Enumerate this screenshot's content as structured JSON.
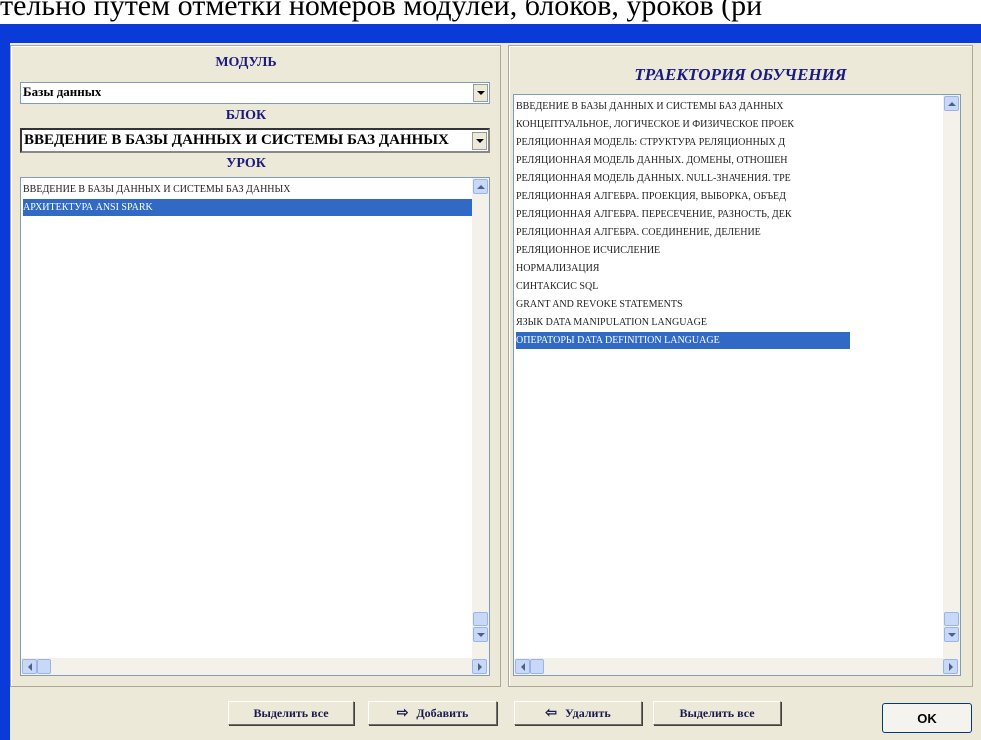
{
  "top_text": "тельно путем отметки номеров модулей, блоков, уроков (ри",
  "left": {
    "module_label": "МОДУЛЬ",
    "module_value": "Базы данных",
    "block_label": "БЛОК",
    "block_value": "ВВЕДЕНИЕ В БАЗЫ ДАННЫХ И СИСТЕМЫ  БАЗ ДАННЫХ",
    "lesson_label": "УРОК",
    "lessons": [
      {
        "text": "ВВЕДЕНИЕ В БАЗЫ ДАННЫХ И СИСТЕМЫ  БАЗ ДАННЫХ",
        "selected": false
      },
      {
        "text": "АРХИТЕКТУРА ANSI SPARK",
        "selected": true
      }
    ]
  },
  "right": {
    "title": "ТРАЕКТОРИЯ ОБУЧЕНИЯ",
    "items": [
      {
        "text": "ВВЕДЕНИЕ В БАЗЫ ДАННЫХ И СИСТЕМЫ  БАЗ ДАННЫХ",
        "selected": false
      },
      {
        "text": "КОНЦЕПТУАЛЬНОЕ, ЛОГИЧЕСКОЕ И ФИЗИЧЕСКОЕ ПРОЕК",
        "selected": false
      },
      {
        "text": "РЕЛЯЦИОННАЯ МОДЕЛЬ: СТРУКТУРА РЕЛЯЦИОННЫХ Д",
        "selected": false
      },
      {
        "text": "РЕЛЯЦИОННАЯ МОДЕЛЬ ДАННЫХ. ДОМЕНЫ, ОТНОШЕН",
        "selected": false
      },
      {
        "text": "РЕЛЯЦИОННАЯ МОДЕЛЬ ДАННЫХ. NULL-ЗНАЧЕНИЯ. ТРЕ",
        "selected": false
      },
      {
        "text": "РЕЛЯЦИОННАЯ АЛГЕБРА. ПРОЕКЦИЯ, ВЫБОРКА, ОБЪЕД",
        "selected": false
      },
      {
        "text": "РЕЛЯЦИОННАЯ АЛГЕБРА. ПЕРЕСЕЧЕНИЕ, РАЗНОСТЬ, ДЕК",
        "selected": false
      },
      {
        "text": "РЕЛЯЦИОННАЯ АЛГЕБРА. СОЕДИНЕНИЕ, ДЕЛЕНИЕ",
        "selected": false
      },
      {
        "text": "РЕЛЯЦИОННОЕ ИСЧИСЛЕНИЕ",
        "selected": false
      },
      {
        "text": "НОРМАЛИЗАЦИЯ",
        "selected": false
      },
      {
        "text": "СИНТАКСИС SQL",
        "selected": false
      },
      {
        "text": "GRANT AND REVOKE STATEMENTS",
        "selected": false
      },
      {
        "text": "ЯЗЫК DATA MANIPULATION LANGUAGE",
        "selected": false
      },
      {
        "text": "ОПЕРАТОРЫ DATA DEFINITION LANGUAGE",
        "selected": true
      }
    ]
  },
  "buttons": {
    "select_all_left": "Выделить все",
    "add": "Добавить",
    "remove": "Удалить",
    "select_all_right": "Выделить все",
    "ok": "OK"
  },
  "colors": {
    "title_bar": "#0a3bd8",
    "selection": "#316ac5",
    "header_text": "#1a1a80",
    "window_bg": "#ece9d8"
  }
}
